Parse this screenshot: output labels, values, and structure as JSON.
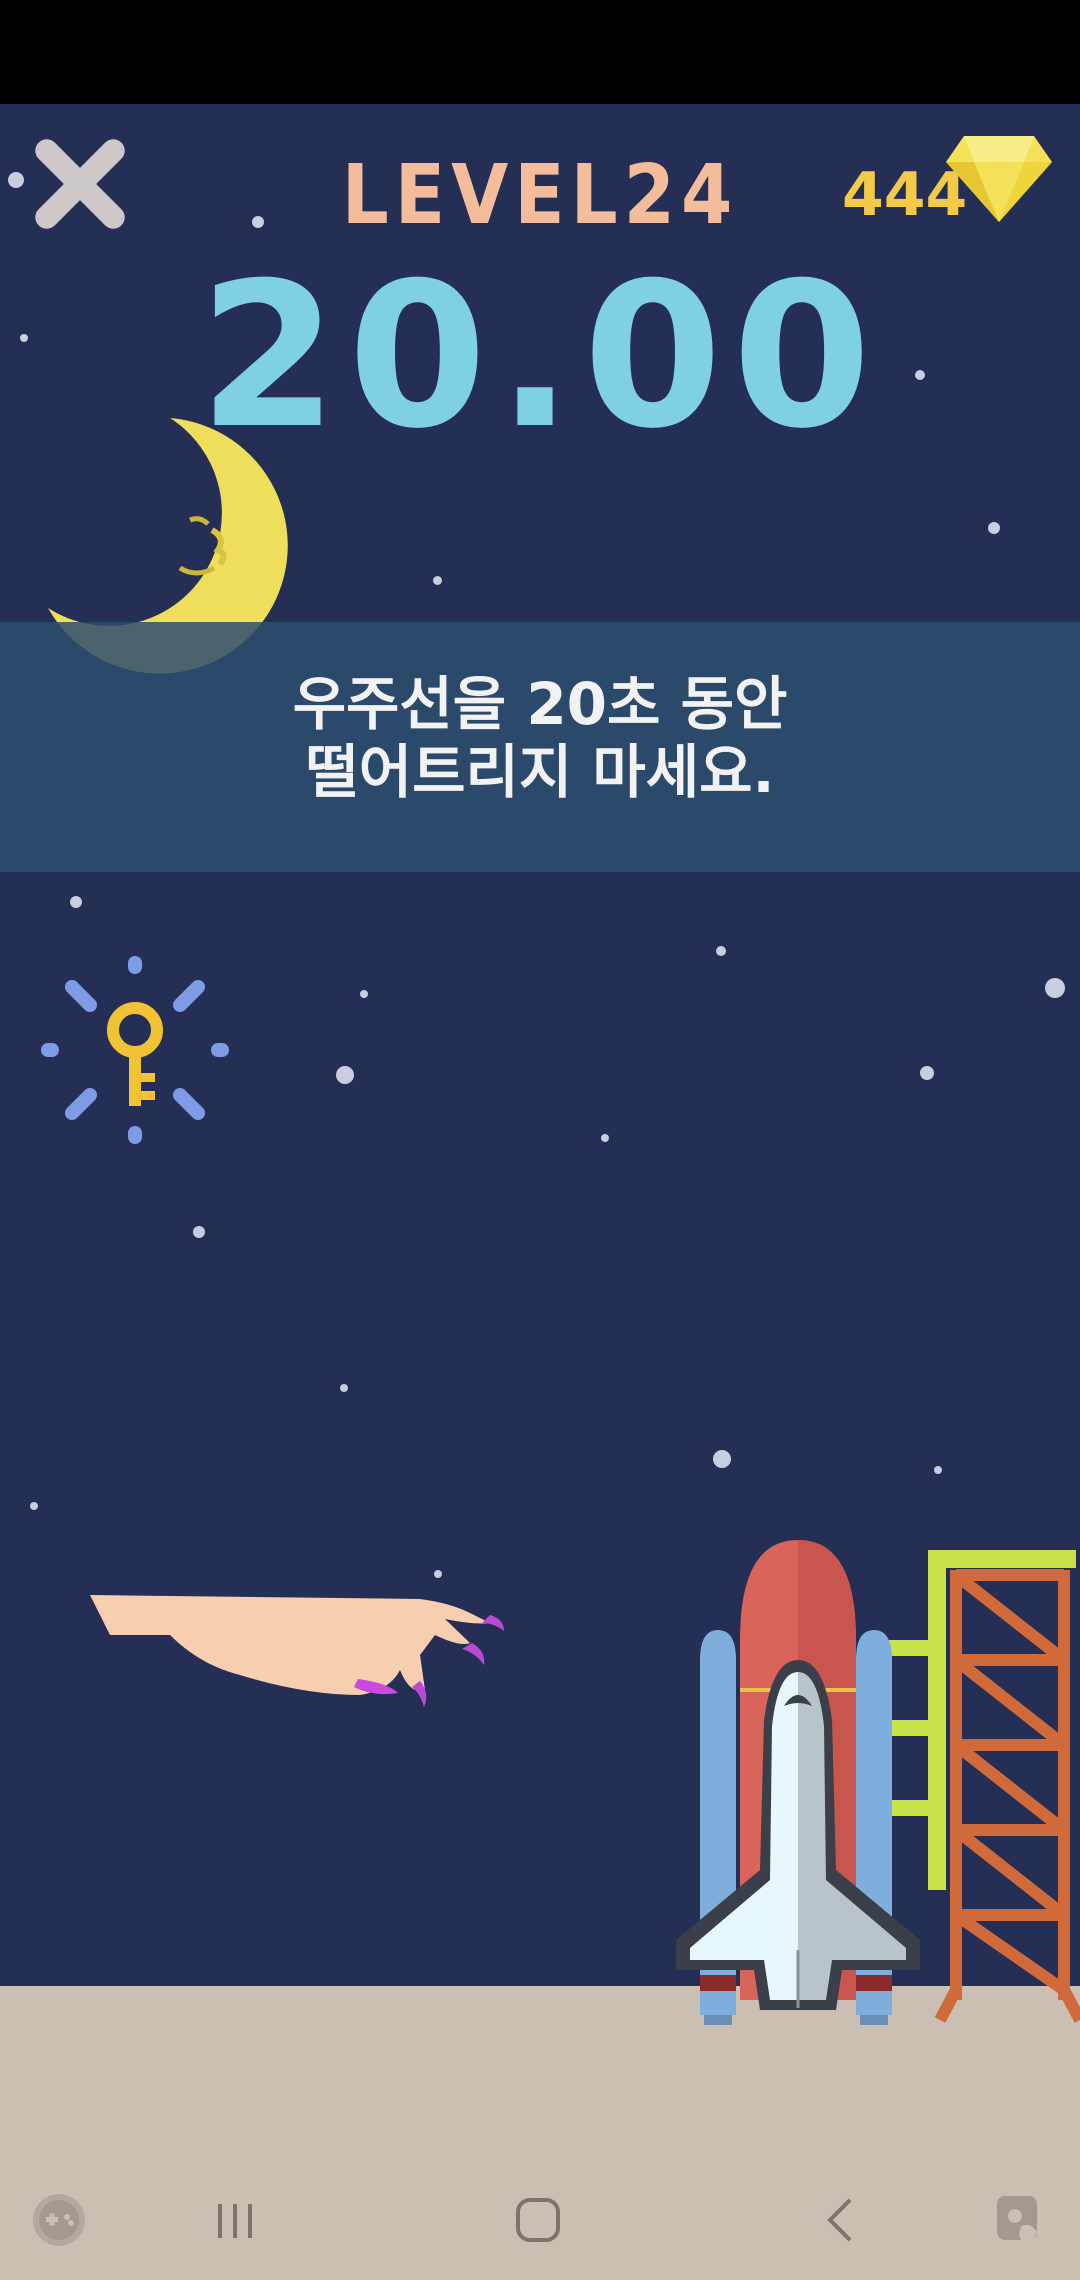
{
  "header": {
    "level_label": "LEVEL24",
    "timer": "20.00",
    "gem_count": "444"
  },
  "mission": {
    "line1": "우주선을 20초 동안",
    "line2": "떨어트리지 마세요."
  },
  "colors": {
    "sky": "#252f55",
    "ground": "#cbbfb4",
    "level_text": "#f3bd9b",
    "timer_text": "#7fd0e2",
    "gem": "#f3c94a"
  },
  "icons": {
    "close": "close-icon",
    "gem": "diamond-icon",
    "hint": "key-icon",
    "nav_game": "game-tools-icon",
    "nav_recents": "recents-icon",
    "nav_home": "home-icon",
    "nav_back": "back-icon",
    "nav_assist": "assistant-icon"
  }
}
